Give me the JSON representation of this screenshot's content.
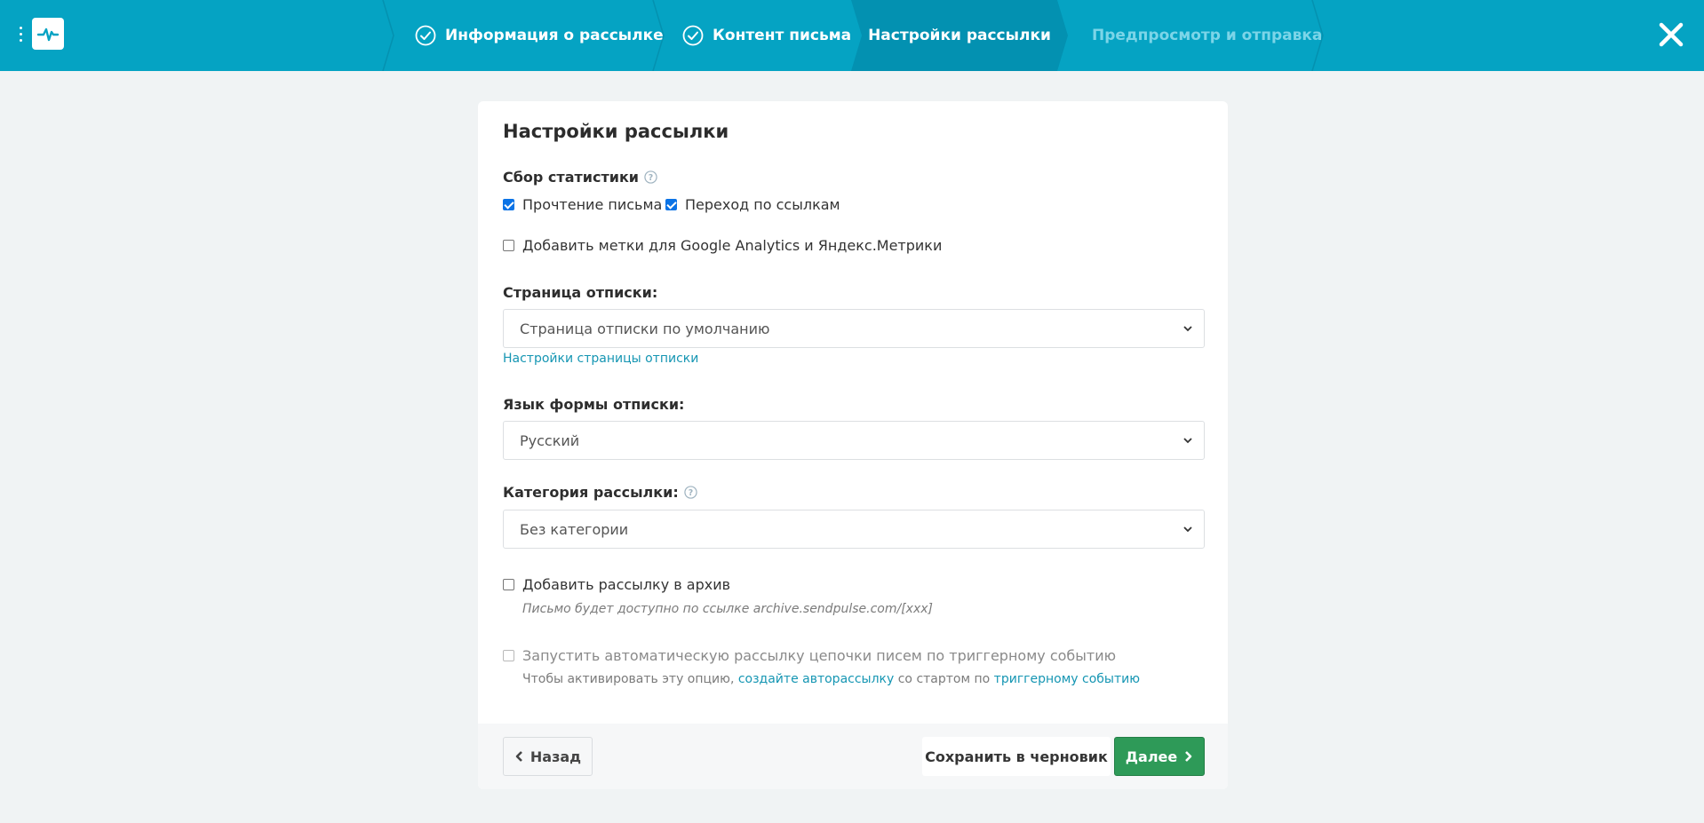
{
  "header": {
    "steps": [
      {
        "label": "Информация о рассылке",
        "state": "done"
      },
      {
        "label": "Контент письма",
        "state": "done"
      },
      {
        "label": "Настройки рассылки",
        "state": "active"
      },
      {
        "label": "Предпросмотр и отправка",
        "state": "pending"
      }
    ],
    "colors": {
      "bar": "#05a3c3",
      "active": "#0391b1"
    }
  },
  "card": {
    "title": "Настройки рассылки",
    "stats": {
      "label": "Сбор статистики",
      "open_label": "Прочтение письма",
      "open_checked": true,
      "clicks_label": "Переход по ссылкам",
      "clicks_checked": true,
      "utm_label": "Добавить метки для Google Analytics и Яндекс.Метрики",
      "utm_checked": false
    },
    "unsubscribe_page": {
      "label": "Страница отписки:",
      "value": "Страница отписки по умолчанию",
      "settings_link": "Настройки страницы отписки"
    },
    "unsubscribe_lang": {
      "label": "Язык формы отписки:",
      "value": "Русский"
    },
    "category": {
      "label": "Категория рассылки:",
      "value": "Без категории"
    },
    "archive": {
      "label": "Добавить рассылку в архив",
      "checked": false,
      "hint": "Письмо будет доступно по ссылке archive.sendpulse.com/[xxx]"
    },
    "trigger": {
      "label": "Запустить автоматическую рассылку цепочки писем по триггерному событию",
      "checked": false,
      "hint_prefix": "Чтобы активировать эту опцию, ",
      "hint_link1": "создайте авторассылку",
      "hint_middle": " со стартом по ",
      "hint_link2": "триггерному событию"
    }
  },
  "footer": {
    "back_label": "Назад",
    "draft_label": "Сохранить в черновик",
    "next_label": "Далее",
    "next_color": "#2e9a58"
  }
}
